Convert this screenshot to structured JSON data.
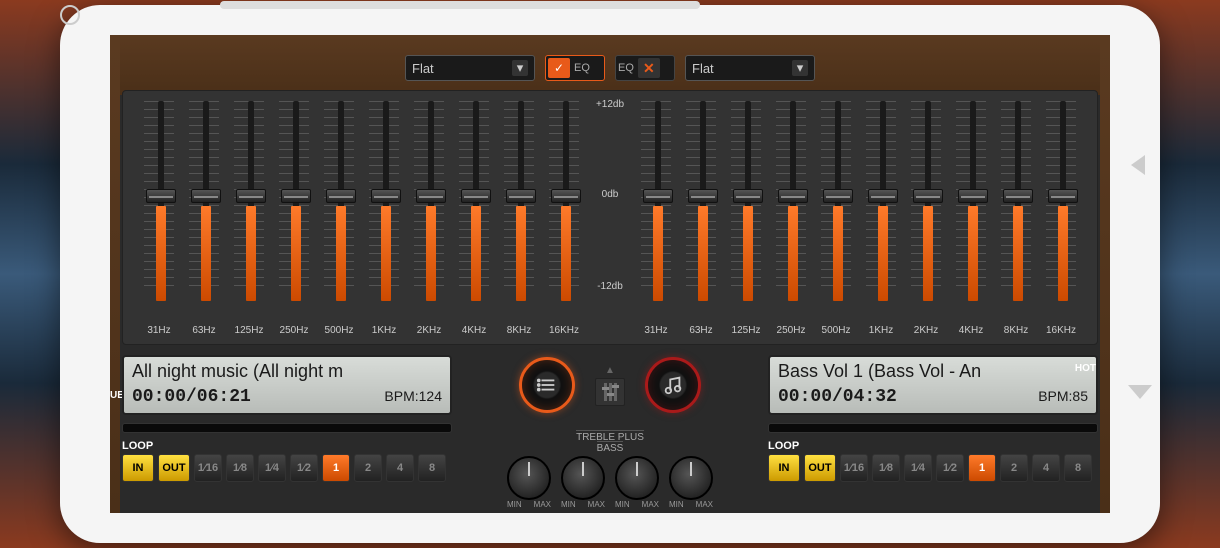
{
  "eq": {
    "presetLeft": "Flat",
    "presetRight": "Flat",
    "labelLeft": "EQ",
    "labelRight": "EQ",
    "dbTop": "+12db",
    "dbMid": "0db",
    "dbBot": "-12db",
    "freqs": [
      "31Hz",
      "63Hz",
      "125Hz",
      "250Hz",
      "500Hz",
      "1KHz",
      "2KHz",
      "4KHz",
      "8KHz",
      "16KHz"
    ],
    "slidersLeft": [
      0,
      0,
      0,
      0,
      0,
      0,
      0,
      0,
      0,
      0
    ],
    "slidersRight": [
      0,
      0,
      0,
      0,
      0,
      0,
      0,
      0,
      0,
      0
    ]
  },
  "deckA": {
    "title": "All night music (All night m",
    "time": "00:00/06:21",
    "bpmLabel": "BPM:",
    "bpm": "124"
  },
  "deckB": {
    "title": "Bass Vol 1 (Bass Vol - An",
    "time": "00:00/04:32",
    "bpmLabel": "BPM:",
    "bpm": "85"
  },
  "loop": {
    "label": "LOOP",
    "in": "IN",
    "out": "OUT",
    "beatsA": [
      "1⁄16",
      "1⁄8",
      "1⁄4",
      "1⁄2",
      "1",
      "2",
      "4",
      "8"
    ],
    "activeA": 4,
    "beatsB": [
      "1⁄16",
      "1⁄8",
      "1⁄4",
      "1⁄2",
      "1",
      "2",
      "4",
      "8"
    ],
    "activeB": 4,
    "cue": "UE",
    "hot": "HOT"
  },
  "tone": {
    "treble": "TREBLE PLUS",
    "bass": "BASS",
    "min": "MIN",
    "max": "MAX"
  }
}
